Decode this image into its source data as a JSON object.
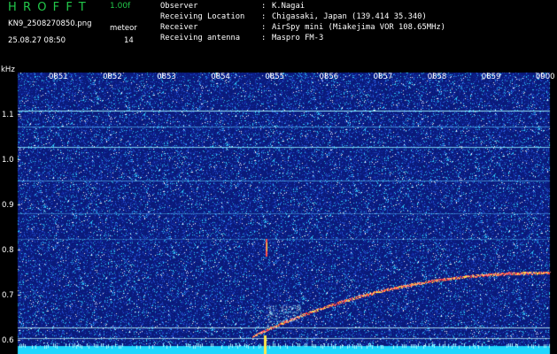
{
  "header": {
    "app_title": "HROFFT",
    "version": "1.00f",
    "filename": "KN9_2508270850.png",
    "label_meteor": "meteor",
    "date_time": "25.08.27 08:50",
    "meteor_count": "14",
    "info": [
      {
        "label": "Observer",
        "value": "K.Nagai"
      },
      {
        "label": "Receiving Location",
        "value": "Chigasaki, Japan (139.414 35.340)"
      },
      {
        "label": "Receiver",
        "value": "AirSpy mini (Miakejima VOR 108.65MHz)"
      },
      {
        "label": "Receiving antenna",
        "value": "Maspro FM-3"
      }
    ]
  },
  "spectrogram": {
    "y_unit": "kHz",
    "time_ticks": [
      "0851",
      "0852",
      "0853",
      "0854",
      "0855",
      "0856",
      "0857",
      "0858",
      "0859",
      "0900"
    ],
    "freq_ticks": [
      "1.1",
      "1.0",
      "0.9",
      "0.8",
      "0.7",
      "0.6"
    ],
    "colors": {
      "background": "#0a1a7a",
      "noise_cyan": "#2fd0ff",
      "noise_white": "#ffffff",
      "bottom_band": "#1fd7ff",
      "trail_red": "#ff3a3a",
      "trail_yellow": "#ffe94a",
      "tick_text": "#ffffff"
    }
  }
}
